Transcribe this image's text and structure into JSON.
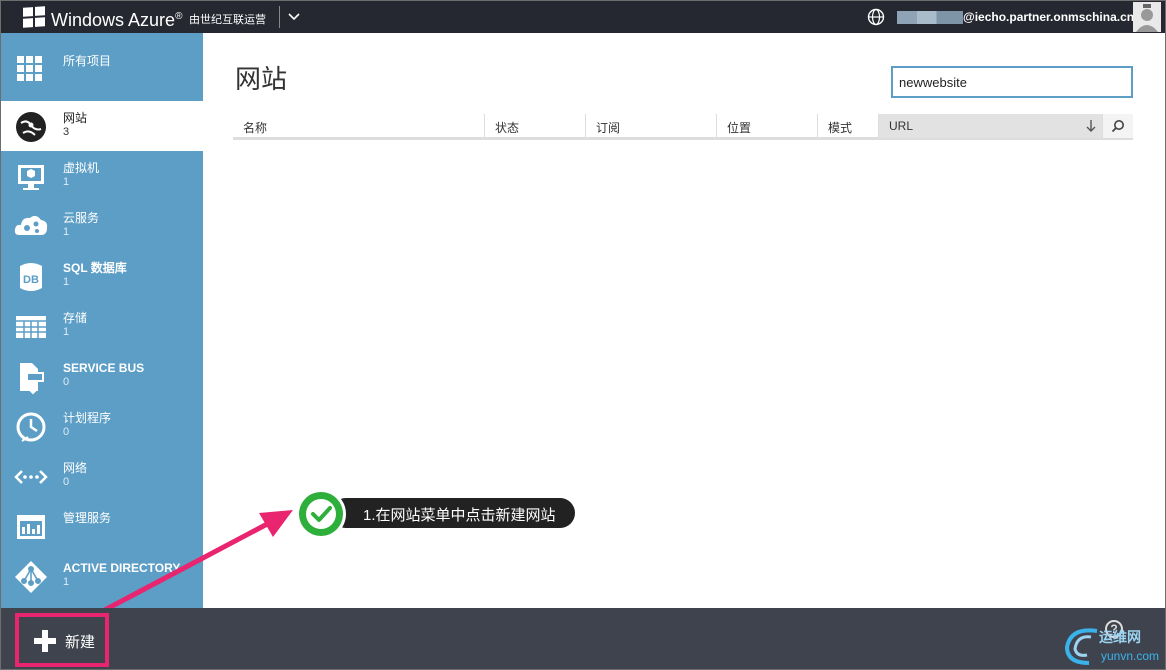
{
  "topbar": {
    "brand": "Windows Azure",
    "brand_mark": "®",
    "operator": "由世纪互联运营",
    "email": "@iecho.partner.onmschina.cn"
  },
  "sidebar": {
    "items": [
      {
        "label": "所有项目",
        "count": "",
        "icon": "grid-icon"
      },
      {
        "label": "网站",
        "count": "3",
        "icon": "globe-web-icon"
      },
      {
        "label": "虚拟机",
        "count": "1",
        "icon": "monitor-icon"
      },
      {
        "label": "云服务",
        "count": "1",
        "icon": "cloud-gears-icon"
      },
      {
        "label": "SQL 数据库",
        "count": "1",
        "icon": "database-icon"
      },
      {
        "label": "存储",
        "count": "1",
        "icon": "table-storage-icon"
      },
      {
        "label": "SERVICE BUS",
        "count": "0",
        "icon": "service-bus-icon"
      },
      {
        "label": "计划程序",
        "count": "0",
        "icon": "clock-icon"
      },
      {
        "label": "网络",
        "count": "0",
        "icon": "network-icon"
      },
      {
        "label": "管理服务",
        "count": "",
        "icon": "management-icon"
      },
      {
        "label": "ACTIVE DIRECTORY",
        "count": "1",
        "icon": "directory-icon"
      }
    ]
  },
  "main": {
    "title": "网站",
    "search_value": "newwebsite",
    "columns": [
      "名称",
      "状态",
      "订阅",
      "位置",
      "模式",
      "URL"
    ]
  },
  "callout": {
    "text": "1.在网站菜单中点击新建网站"
  },
  "bottombar": {
    "new_label": "新建",
    "help": "?",
    "watermark_top": "运维网",
    "watermark_bottom": "yunvn.com"
  },
  "colors": {
    "topbar": "#252830",
    "sidebar": "#5c9ec6",
    "bottombar": "#3f434e",
    "highlight": "#e8256e",
    "check_green": "#2eae3a"
  }
}
